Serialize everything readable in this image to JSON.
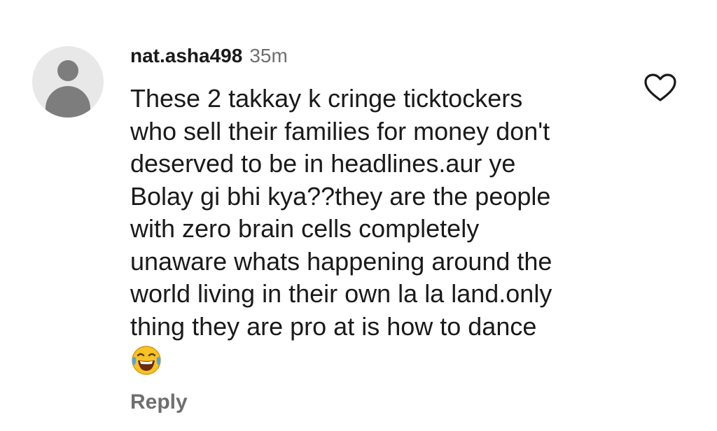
{
  "comment": {
    "username": "nat.asha498",
    "time": "35m",
    "lines": [
      "These 2 takkay k cringe ticktockers",
      "who sell their families for money don't",
      "deserved to be in headlines.aur ye",
      "Bolay gi bhi kya??they are the people",
      "with zero brain cells completely",
      "unaware whats happening around the",
      "world living in their own la la land.only",
      "thing they are pro at is how to dance"
    ],
    "emoji": "face-with-tears-of-joy",
    "reply_label": "Reply",
    "like_icon": "heart-outline-icon"
  },
  "colors": {
    "text": "#1a1a1a",
    "muted": "#6f6f6f",
    "avatar_bg": "#e8e8e8",
    "avatar_fg": "#7d7d7d",
    "emoji_yellow": "#f7c325"
  }
}
